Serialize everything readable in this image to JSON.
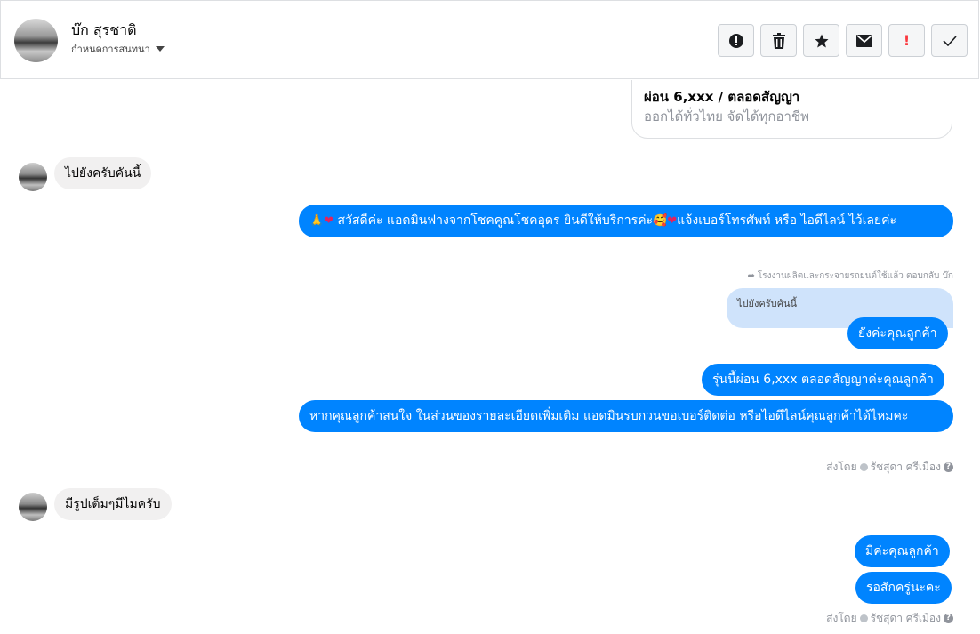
{
  "header": {
    "name": "บ๊ก สุรชาติ",
    "subtitle": "กำหนดการสนทนา",
    "actions": [
      {
        "icon": "alert-circle-icon",
        "glyph": "❗"
      },
      {
        "icon": "trash-icon",
        "glyph": "🗑"
      },
      {
        "icon": "star-icon",
        "glyph": "★"
      },
      {
        "icon": "envelope-icon",
        "glyph": "✉"
      },
      {
        "icon": "exclamation-icon",
        "glyph": "!"
      },
      {
        "icon": "check-icon",
        "glyph": "✓"
      }
    ]
  },
  "card": {
    "title": "ผ่อน 6,xxx / ตลอดสัญญา",
    "subtitle": "ออกได้ทั่วไทย จัดได้ทุกอาชีพ"
  },
  "messages": {
    "in1": "ไปยังครับคันนี้",
    "out1": "สวัสดีค่ะ แอดมินฟางจากโชคคูณโชคอุดร ยินดีให้บริการค่ะ",
    "out1_tail": "แจ้งเบอร์โทรศัพท์ หรือ ไอดีไลน์  ไว้เลยค่ะ",
    "reply_meta": "โรงงานผลิตและกระจายรถยนต์ใช้แล้ว ตอบกลับ บ๊ก",
    "reply_quote": "ไปยังครับคันนี้",
    "out2": "ยังค่ะคุณลูกค้า",
    "out3": "รุ่นนี้ผ่อน 6,xxx ตลอดสัญญาค่ะคุณลูกค้า",
    "out4": "หากคุณลูกค้าสนใจ ในส่วนของรายละเอียดเพิ่มเติม แอดมินรบกวนขอเบอร์ติดต่อ หรือไอดีไลน์คุณลูกค้าได้ไหมคะ",
    "sent_label": "ส่งโดย",
    "sent_by": "รัชสุดา ศรีเมือง",
    "in2": "มีรูปเต็มๆมีไมครับ",
    "out5": "มีค่ะคุณลูกค้า",
    "out6": "รอสักครู่นะคะ",
    "sent_label2": "ส่งโดย",
    "sent_by2": "รัชสุดา ศรีเมือง"
  },
  "colors": {
    "outgoing": "#0084ff",
    "incoming": "#f1f0f0",
    "quote": "#cfe3fb"
  }
}
